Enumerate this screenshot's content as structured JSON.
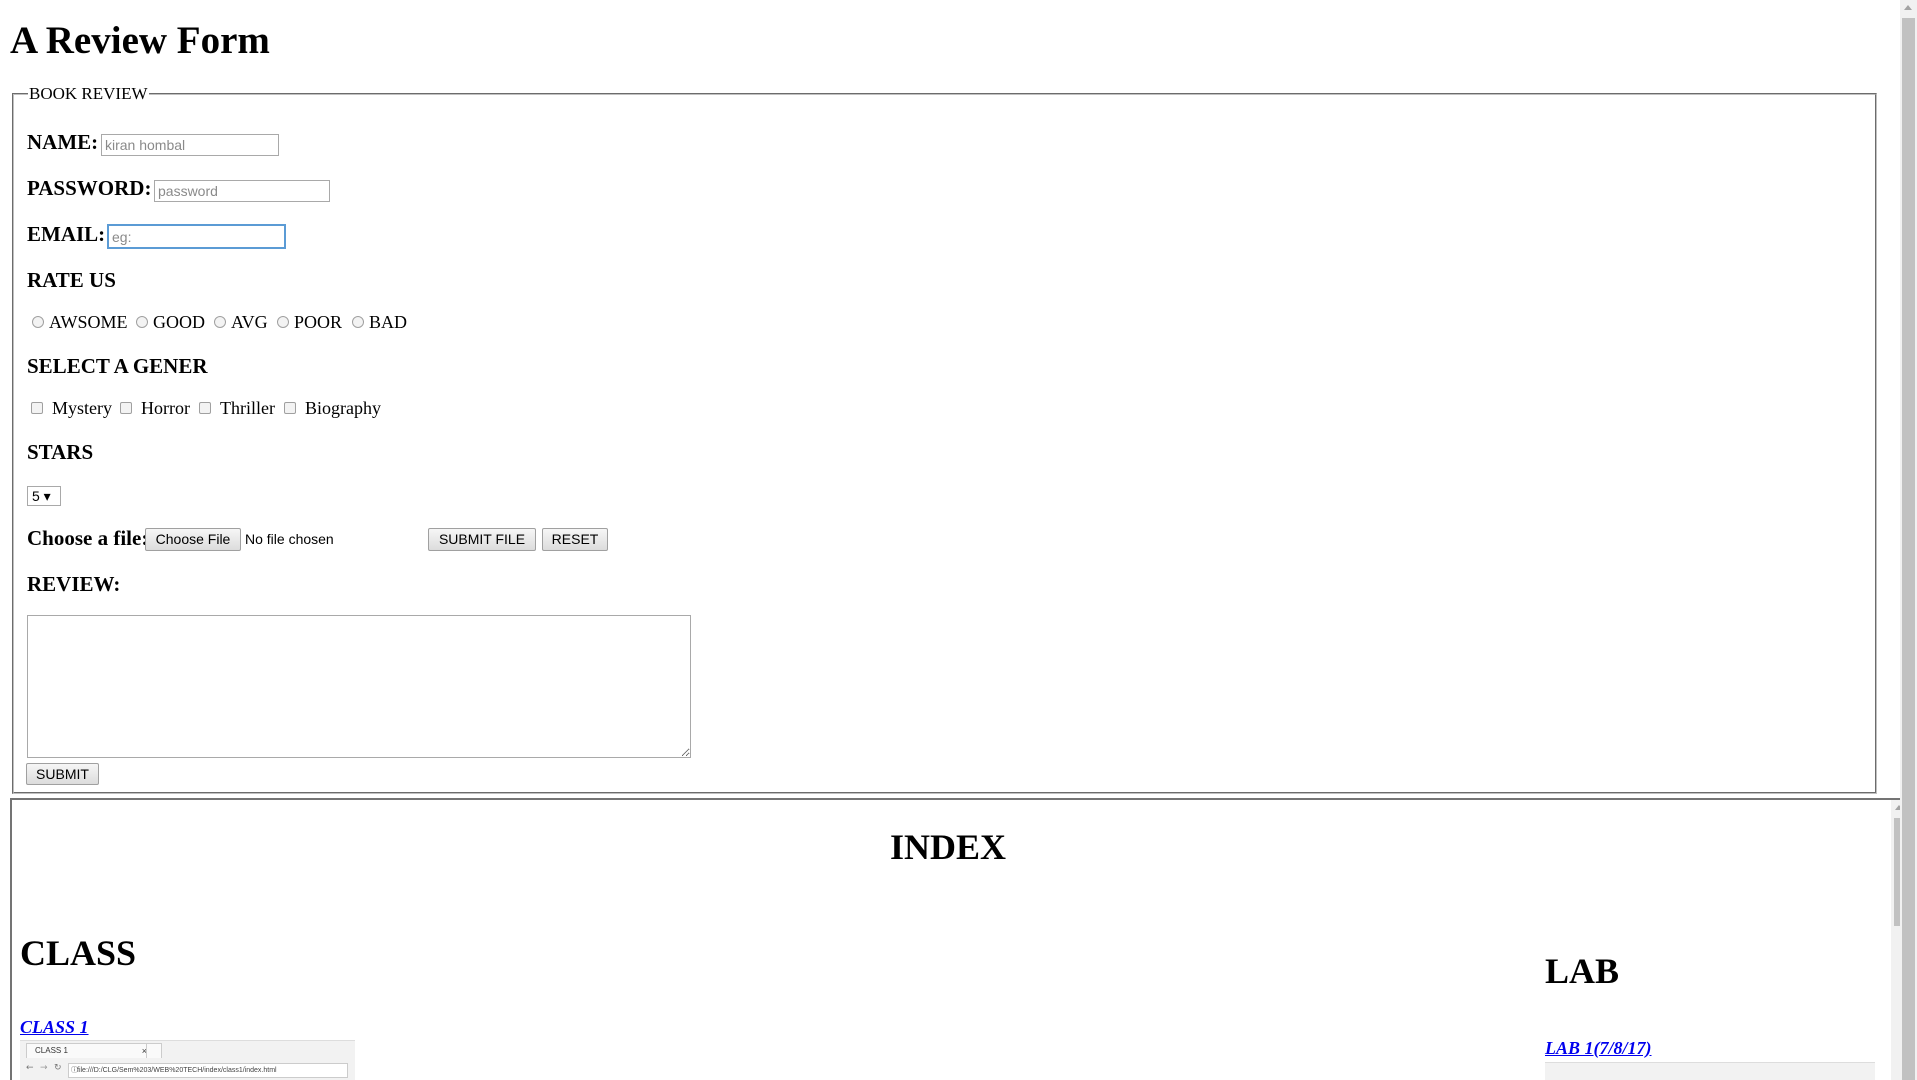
{
  "page": {
    "title": "A Review Form"
  },
  "form": {
    "legend": "BOOK REVIEW",
    "name_label": "NAME:",
    "name_placeholder": "kiran hombal",
    "password_label": "PASSWORD:",
    "password_placeholder": "password",
    "email_label": "EMAIL:",
    "email_placeholder": "eg:",
    "rate_heading": "RATE US",
    "rate_options": [
      "AWSOME",
      "GOOD",
      "AVG",
      "POOR",
      "BAD"
    ],
    "genre_heading": "SELECT A GENER",
    "genre_options": [
      "Mystery",
      "Horror",
      "Thriller",
      "Biography"
    ],
    "stars_heading": "STARS",
    "stars_selected": "5 ▾",
    "file_label": "Choose a file:",
    "choose_file_button": "Choose File",
    "file_status": "No file chosen",
    "submit_file_button": "SUBMIT FILE",
    "reset_button": "RESET",
    "review_heading": "REVIEW:",
    "submit_button": "SUBMIT"
  },
  "index_frame": {
    "title": "INDEX",
    "class_heading": "CLASS",
    "class_link": "CLASS 1",
    "lab_heading": "LAB",
    "lab_link": "LAB 1(7/8/17)",
    "class_thumb_tab": "CLASS 1",
    "class_thumb_url": "file:///D:/CLG/Sem%203/WEB%20TECH/index/class1/index.html"
  },
  "icons": {
    "close_tab": "close-icon",
    "back": "back-arrow-icon",
    "forward": "forward-arrow-icon",
    "reload": "reload-icon",
    "info": "info-icon"
  }
}
